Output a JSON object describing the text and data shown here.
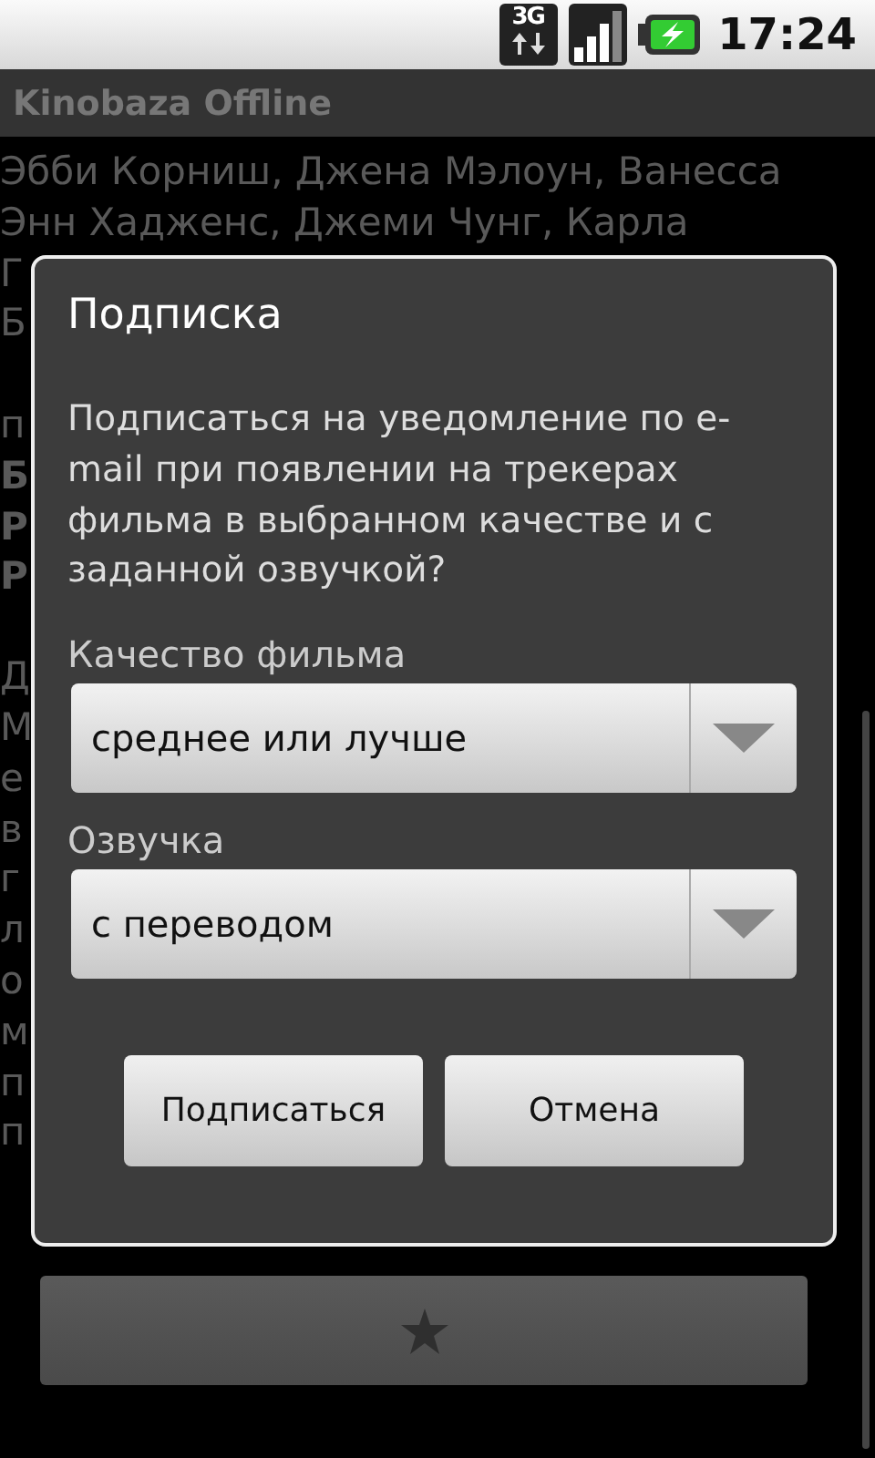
{
  "status_bar": {
    "network": "3G",
    "time": "17:24"
  },
  "app_title": "Kinobaza Offline",
  "background_text": [
    [
      {
        "text": "Эбби Корниш, Джена Мэлоун, Ванесса",
        "bold": false
      },
      {
        "text": "Энн Хадженс, Джеми Чунг, Карла",
        "bold": false
      },
      {
        "text": "Г",
        "bold": false
      },
      {
        "text": "Б",
        "bold": false
      },
      {
        "text": "п",
        "bold": false
      },
      {
        "text": "Б",
        "bold": true
      },
      {
        "text": "Р",
        "bold": true
      },
      {
        "text": "Р",
        "bold": true
      }
    ],
    [
      {
        "text": "Д",
        "bold": false
      },
      {
        "text": "М",
        "bold": false
      },
      {
        "text": "е",
        "bold": false
      },
      {
        "text": "в",
        "bold": false
      },
      {
        "text": "г",
        "bold": false
      },
      {
        "text": "л",
        "bold": false
      },
      {
        "text": "о",
        "bold": false
      },
      {
        "text": "м",
        "bold": false
      },
      {
        "text": "п",
        "bold": false
      },
      {
        "text": "п",
        "bold": false
      }
    ]
  ],
  "dialog": {
    "title": "Подписка",
    "message": "Подписаться на уведомление по e-mail при появлении на трекерах фильма в выбранном качестве и с заданной озвучкой?",
    "fields": [
      {
        "label": "Качество фильма",
        "value": "среднее или лучше"
      },
      {
        "label": "Озвучка",
        "value": "с переводом"
      }
    ],
    "buttons": [
      "Подписаться",
      "Отмена"
    ]
  }
}
